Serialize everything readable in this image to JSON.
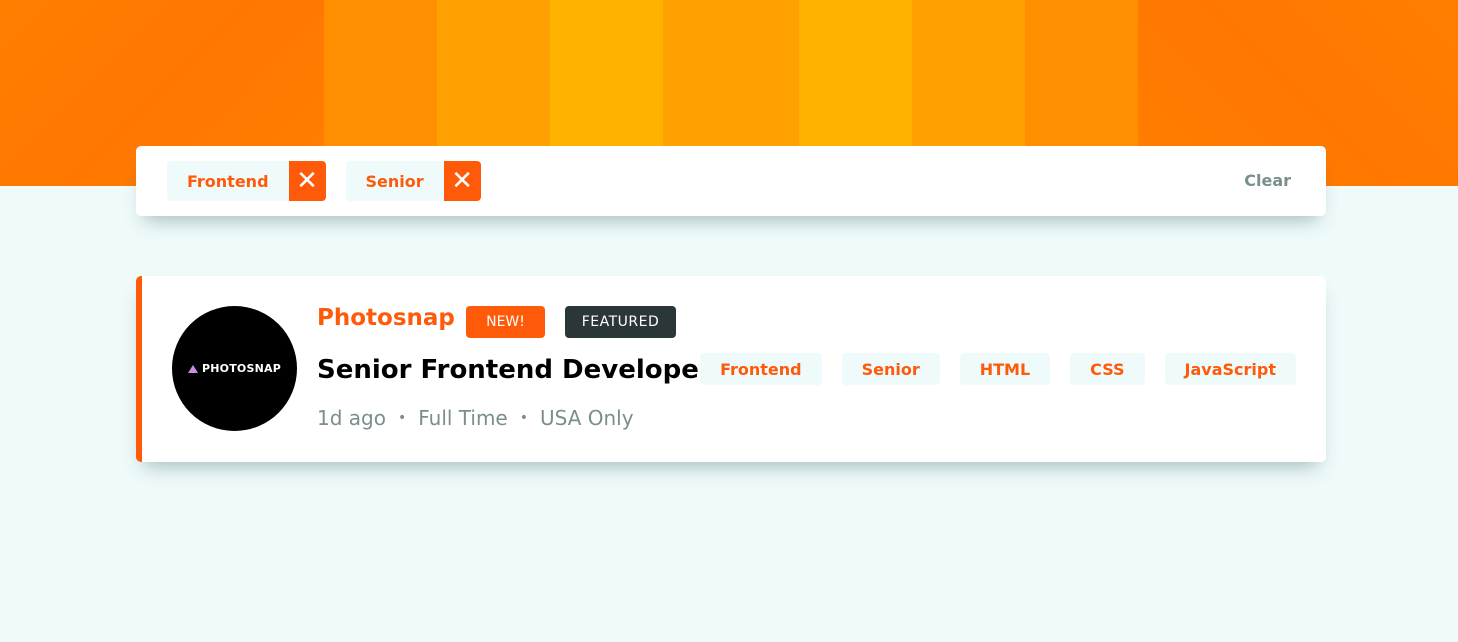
{
  "filter_bar": {
    "chips": [
      {
        "label": "Frontend",
        "remove_icon": "close-icon"
      },
      {
        "label": "Senior",
        "remove_icon": "close-icon"
      }
    ],
    "clear_label": "Clear"
  },
  "job": {
    "logo_text": "PHOTOSNAP",
    "company": "Photosnap",
    "badges": {
      "new": "NEW!",
      "featured": "FEATURED"
    },
    "position": "Senior Frontend Developer",
    "posted": "1d ago",
    "contract": "Full Time",
    "location": "USA Only",
    "separator": "•",
    "tags": [
      "Frontend",
      "Senior",
      "HTML",
      "CSS",
      "JavaScript"
    ]
  },
  "colors": {
    "accent": "#ff5a0a",
    "featured": "#2b3639",
    "page_background": "#effafa",
    "muted_text": "#7b8e8e",
    "banner_orange": "#ff7b00",
    "banner_yellow": "#ffb300"
  }
}
